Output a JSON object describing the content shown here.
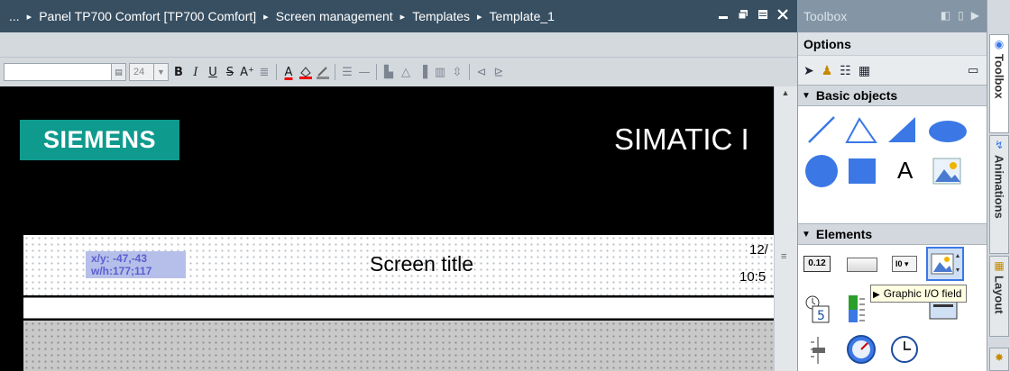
{
  "editor": {
    "breadcrumb": [
      "...",
      "Panel TP700 Comfort [TP700 Comfort]",
      "Screen management",
      "Templates",
      "Template_1"
    ],
    "breadcrumb_separator": "▸",
    "window_buttons": [
      "minimize-icon",
      "float-icon",
      "maximize-icon",
      "close-icon"
    ]
  },
  "format_toolbar": {
    "font_name": "",
    "font_size": "24",
    "bold_label": "B",
    "italic_label": "I",
    "underline_label": "U",
    "strike_label": "S"
  },
  "screen": {
    "logo_text": "SIEMENS",
    "brand_text": "SIMATIC I",
    "coord_xy": "x/y: -47,-43",
    "coord_wh": "w/h:177;117",
    "screen_title": "Screen title",
    "date_text": "12/",
    "time_text": "10:5"
  },
  "toolbox": {
    "title": "Toolbox",
    "options_label": "Options",
    "basic_objects_label": "Basic objects",
    "elements_label": "Elements",
    "text_field_glyph": "A",
    "io_field_glyph": "0.12",
    "symbolic_io_glyph": "I0",
    "tooltip": "Graphic I/O field"
  },
  "side_tabs": {
    "toolbox": "Toolbox",
    "animations": "Animations",
    "layout": "Layout"
  },
  "colors": {
    "titlebar": "#384f62",
    "siemens_petrol": "#0f9a8e",
    "toolbox_header": "#8496a6",
    "shape_blue": "#3b78e6"
  }
}
